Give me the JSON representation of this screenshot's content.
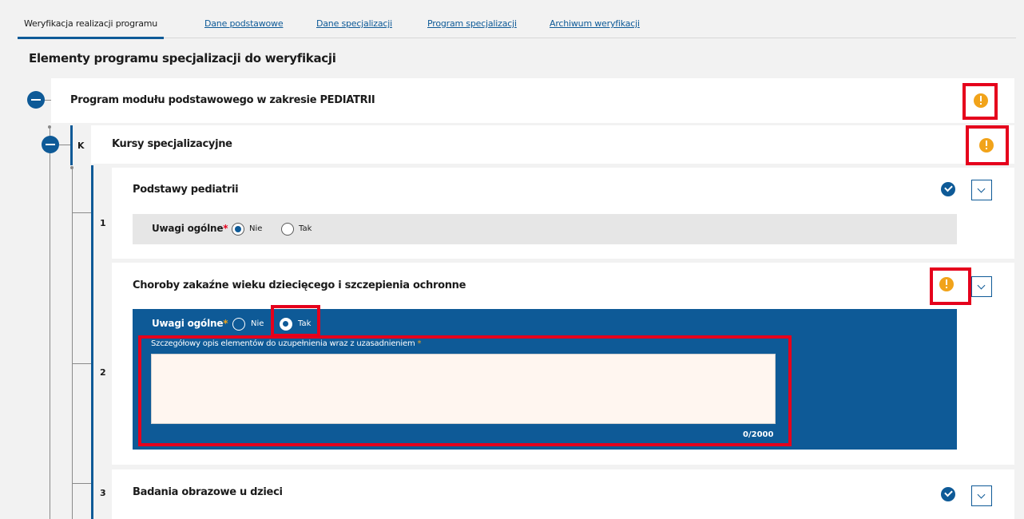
{
  "tabs": [
    {
      "label": "Weryfikacja realizacji programu",
      "active": true
    },
    {
      "label": "Dane podstawowe",
      "active": false
    },
    {
      "label": "Dane specjalizacji",
      "active": false
    },
    {
      "label": "Program specjalizacji",
      "active": false
    },
    {
      "label": "Archiwum weryfikacji",
      "active": false
    }
  ],
  "page_title": "Elementy programu specjalizacji do weryfikacji",
  "module": {
    "title": "Program modułu podstawowego w zakresie PEDIATRII",
    "status_icon": "warning-icon"
  },
  "group": {
    "letter": "K",
    "title": "Kursy specjalizacyjne",
    "status_icon": "warning-icon"
  },
  "items": [
    {
      "number": "1",
      "title": "Podstawy pediatrii",
      "status_icon": "check-icon",
      "general_remarks_label": "Uwagi ogólne",
      "required_mark": "*",
      "option_no": "Nie",
      "option_yes": "Tak",
      "selected": "Nie"
    },
    {
      "number": "2",
      "title": "Choroby zakaźne wieku dziecięcego i szczepienia ochronne",
      "status_icon": "warning-icon",
      "general_remarks_label": "Uwagi ogólne",
      "required_mark": "*",
      "option_no": "Nie",
      "option_yes": "Tak",
      "selected": "Tak",
      "details_label": "Szczegółowy opis elementów do uzupełnienia wraz z uzasadnieniem",
      "details_value": "",
      "char_counter": "0/2000"
    },
    {
      "number": "3",
      "title": "Badania obrazowe u dzieci",
      "status_icon": "check-icon"
    }
  ],
  "colors": {
    "primary": "#0e5a97",
    "warning": "#f1a31a",
    "highlight": "#e5001c",
    "textarea_bg": "#fff6f0"
  }
}
